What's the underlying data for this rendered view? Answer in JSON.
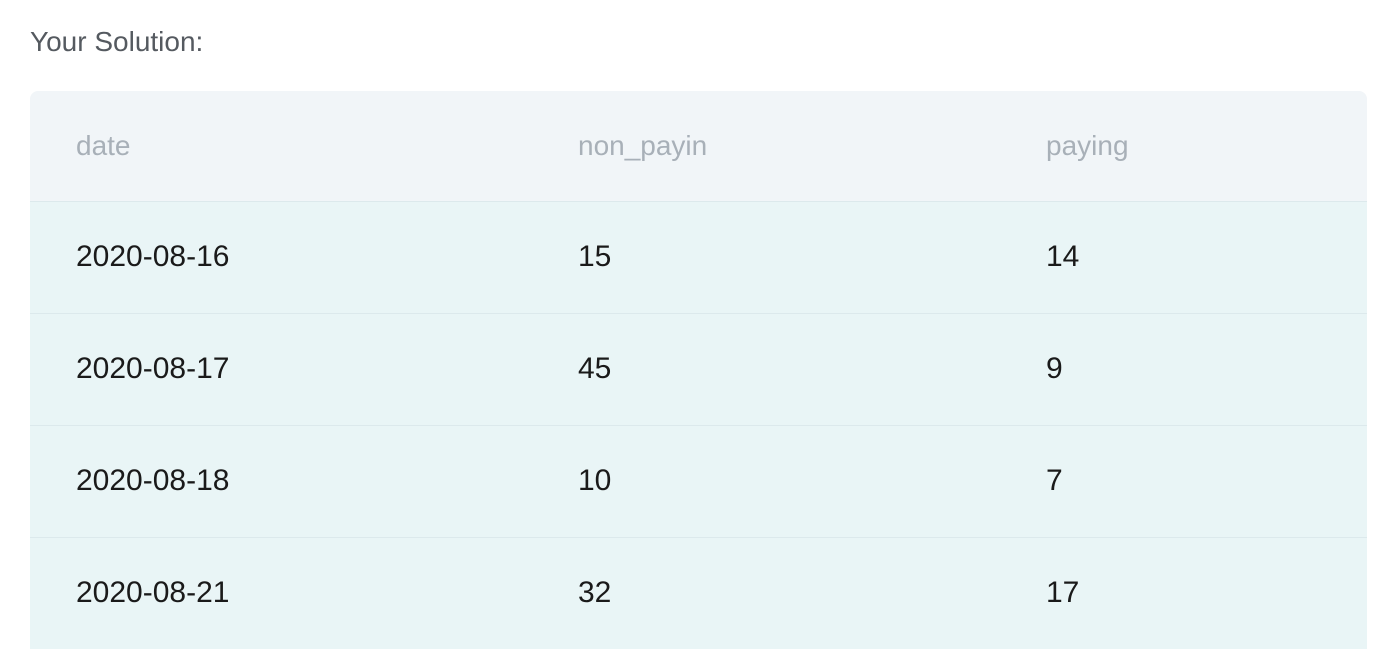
{
  "heading": "Your Solution:",
  "table": {
    "columns": [
      "date",
      "non_payin",
      "paying"
    ],
    "rows": [
      [
        "2020-08-16",
        "15",
        "14"
      ],
      [
        "2020-08-17",
        "45",
        "9"
      ],
      [
        "2020-08-18",
        "10",
        "7"
      ],
      [
        "2020-08-21",
        "32",
        "17"
      ]
    ]
  }
}
